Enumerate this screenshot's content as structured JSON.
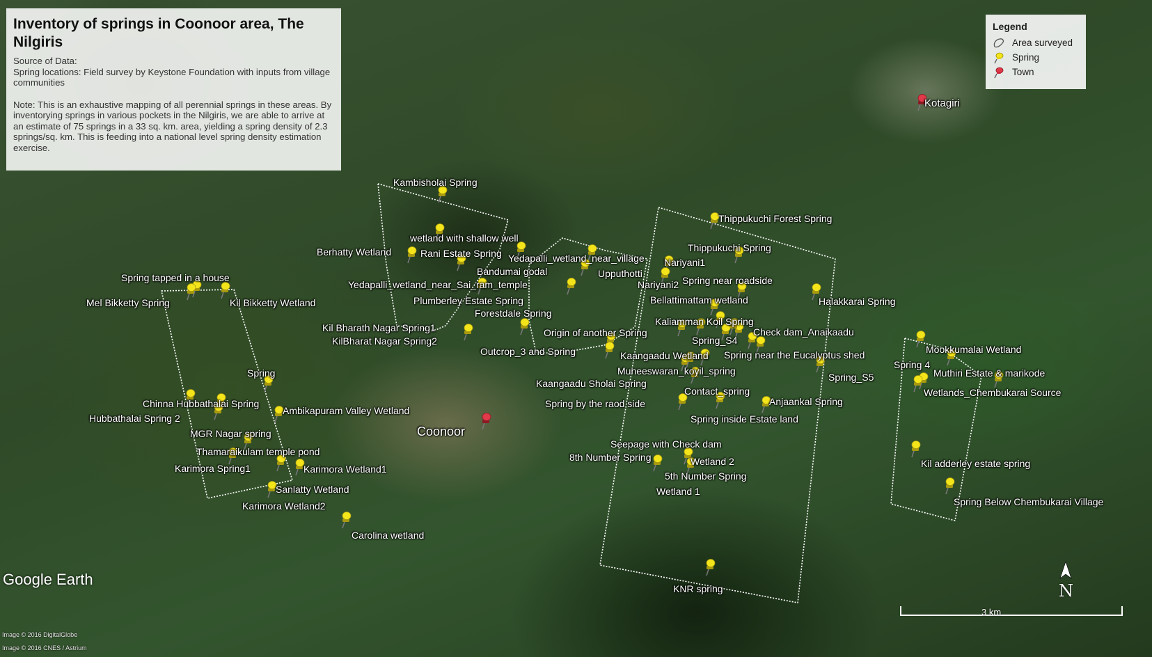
{
  "title": "Inventory of springs in Coonoor area, The Nilgiris",
  "source_lines": [
    "Source of Data:",
    "Spring locations: Field survey by Keystone Foundation with inputs from village communities"
  ],
  "note": "Note: This is an exhaustive mapping of all perennial springs in these areas. By inventorying springs in various pockets in the Nilgiris, we are able to arrive at an estimate of 75 springs in a 33 sq. km. area, yielding a spring density of 2.3 springs/sq. km. This is feeding into a national level spring density estimation exercise.",
  "legend": {
    "heading": "Legend",
    "items": [
      {
        "label": "Area surveyed",
        "icon": "area-outline-icon"
      },
      {
        "label": "Spring",
        "icon": "yellow-pushpin-icon",
        "color": "#f4e51b"
      },
      {
        "label": "Town",
        "icon": "red-pushpin-icon",
        "color": "#e0394a"
      }
    ]
  },
  "colors": {
    "spring": "#f4e51b",
    "town": "#e0394a",
    "boundary": "#ffffff"
  },
  "towns": [
    "Coonoor",
    "Kotagiri"
  ],
  "spring_labels": [
    "Kambisholai Spring",
    "wetland with shallow well",
    "Berhatty Wetland",
    "Rani Estate Spring",
    "Yedapalli_wetland_near_village",
    "Bandumai godal",
    "Upputhotti",
    "Nariyani1",
    "Nariyani2",
    "Yedapalli_wetland_near_Sai_ram_temple",
    "Plumberley Estate Spring",
    "Forestdale Spring",
    "Kil Bharath Nagar Spring1",
    "KilBharat Nagar Spring2",
    "Outcrop_3 and Spring",
    "Origin of another Spring",
    "Spring tapped in a house",
    "Mel Bikketty Spring",
    "Kil Bikketty Wetland",
    "Spring",
    "Chinna Hubbathalai Spring",
    "Hubbathalai Spring 2",
    "Ambikapuram Valley Wetland",
    "MGR Nagar spring",
    "Thamaraikulam temple pond",
    "Karimora Spring1",
    "Karimora Wetland1",
    "Sanlatty Wetland",
    "Karimora Wetland2",
    "Carolina wetland",
    "Thippukuchi Forest Spring",
    "Thippukuchi Spring",
    "Spring near roadside",
    "Bellattimattam wetland",
    "Halakkarai Spring",
    "Kaliamman Koil Spring",
    "Check dam_Anaikaadu",
    "Spring_S4",
    "Kaangaadu Wetland",
    "Spring near the Eucalyptus shed",
    "Muneeswaran_koyil_spring",
    "Kaangaadu Sholai Spring",
    "Spring_S5",
    "Contact_spring",
    "Spring by the raod side",
    "Anjaankal Spring",
    "Spring inside Estate land",
    "Seepage with Check dam",
    "8th Number Spring",
    "Wetland 2",
    "5th Number Spring",
    "Wetland 1",
    "KNR spring",
    "Mookkumalai Wetland",
    "Spring 4",
    "Muthiri Estate & marikode",
    "Wetlands_Chembukarai Source",
    "Kil adderley estate spring",
    "Spring Below Chembukarai Village"
  ],
  "branding": {
    "logo": "Google Earth",
    "credits": [
      "Image © 2016 DigitalGlobe",
      "Image © 2016 CNES / Astrium"
    ]
  },
  "scale": {
    "label": "3 km"
  },
  "north": {
    "label": "N"
  }
}
